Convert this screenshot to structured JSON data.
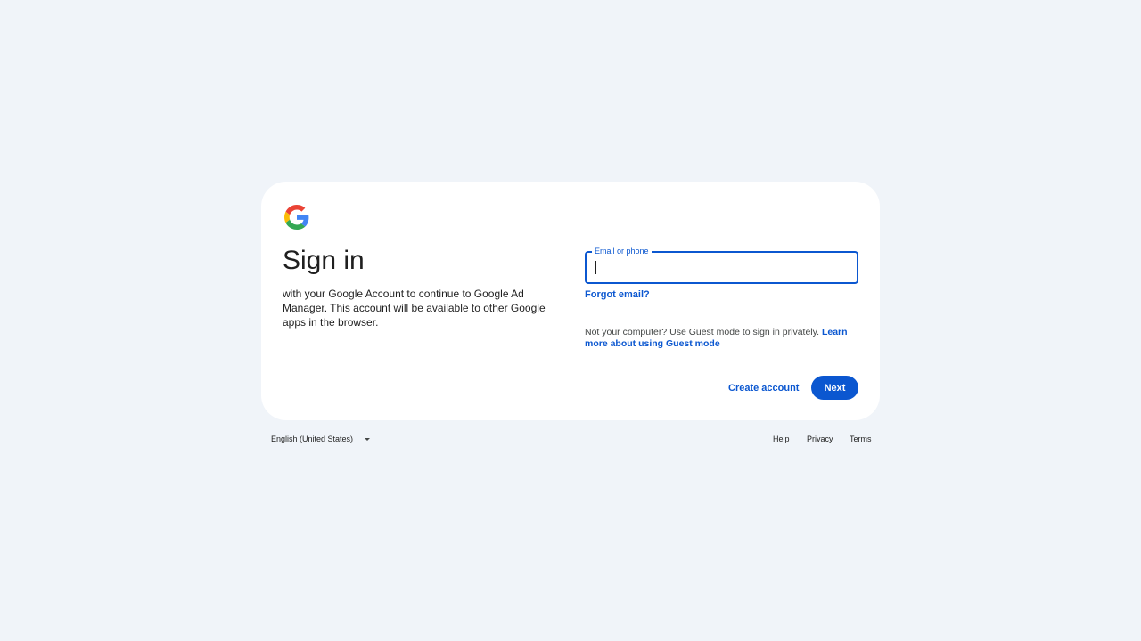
{
  "brand": {
    "logo_icon": "google-g-icon",
    "colors": {
      "blue": "#4285F4",
      "red": "#EA4335",
      "yellow": "#FBBC05",
      "green": "#34A853",
      "accent": "#0b57d0"
    }
  },
  "signin": {
    "title": "Sign in",
    "subtitle": "with your Google Account to continue to Google Ad Manager. This account will be available to other Google apps in the browser."
  },
  "email_field": {
    "label": "Email or phone",
    "value": ""
  },
  "links": {
    "forgot_email": "Forgot email?",
    "guest_text": "Not your computer? Use Guest mode to sign in privately. ",
    "guest_link": "Learn more about using Guest mode"
  },
  "buttons": {
    "create_account": "Create account",
    "next": "Next"
  },
  "footer": {
    "language": "English (United States)",
    "help": "Help",
    "privacy": "Privacy",
    "terms": "Terms"
  }
}
